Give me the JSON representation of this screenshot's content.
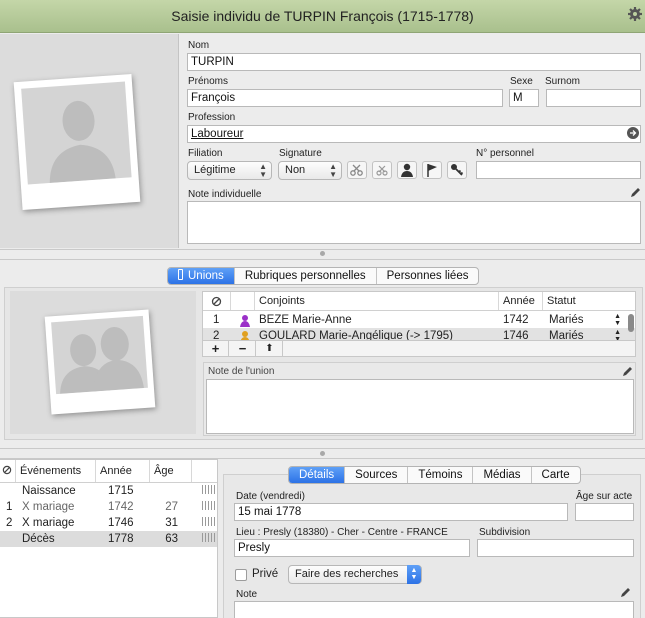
{
  "window": {
    "title": "Saisie individu de TURPIN François (1715-1778)"
  },
  "individual": {
    "nom_label": "Nom",
    "nom": "TURPIN",
    "prenoms_label": "Prénoms",
    "prenoms": "François",
    "sexe_label": "Sexe",
    "sexe": "M",
    "surnom_label": "Surnom",
    "surnom": "",
    "profession_label": "Profession",
    "profession": "Laboureur",
    "filiation_label": "Filiation",
    "filiation": "Légitime",
    "signature_label": "Signature",
    "signature": "Non",
    "numero_label": "N° personnel",
    "numero": "",
    "note_label": "Note individuelle",
    "note": ""
  },
  "unions_tabs": [
    {
      "label": "Unions"
    },
    {
      "label": "Rubriques personnelles"
    },
    {
      "label": "Personnes liées"
    }
  ],
  "unions_table": {
    "headers": {
      "conjoints": "Conjoints",
      "annee": "Année",
      "statut": "Statut"
    },
    "rows": [
      {
        "num": "1",
        "name": "BEZE Marie-Anne",
        "year": "1742",
        "status": "Mariés",
        "sex_color": "#9b30c8"
      },
      {
        "num": "2",
        "name": "GOULARD Marie-Angélique (-> 1795)",
        "year": "1746",
        "status": "Mariés",
        "sex_color": "#e0a020"
      }
    ],
    "add": "+",
    "remove": "−",
    "up": "⬆"
  },
  "union_note_label": "Note de l'union",
  "events_table": {
    "headers": {
      "evenements": "Événements",
      "annee": "Année",
      "age": "Âge"
    },
    "rows": [
      {
        "num": "",
        "label": "Naissance",
        "year": "1715",
        "age": ""
      },
      {
        "num": "1",
        "label": "X mariage",
        "year": "1742",
        "age": "27"
      },
      {
        "num": "2",
        "label": "X mariage",
        "year": "1746",
        "age": "31"
      },
      {
        "num": "",
        "label": "Décès",
        "year": "1778",
        "age": "63"
      }
    ]
  },
  "detail_tabs": [
    {
      "label": "Détails"
    },
    {
      "label": "Sources"
    },
    {
      "label": "Témoins"
    },
    {
      "label": "Médias"
    },
    {
      "label": "Carte"
    }
  ],
  "event_detail": {
    "date_label": "Date (vendredi)",
    "date": "15 mai 1778",
    "age_label": "Âge sur acte",
    "age": "",
    "lieu_label": "Lieu : Presly (18380) - Cher - Centre - FRANCE",
    "lieu": "Presly",
    "subdivision_label": "Subdivision",
    "subdivision": "",
    "prive_label": "Privé",
    "search_label": "Faire des recherches",
    "note_label": "Note"
  }
}
